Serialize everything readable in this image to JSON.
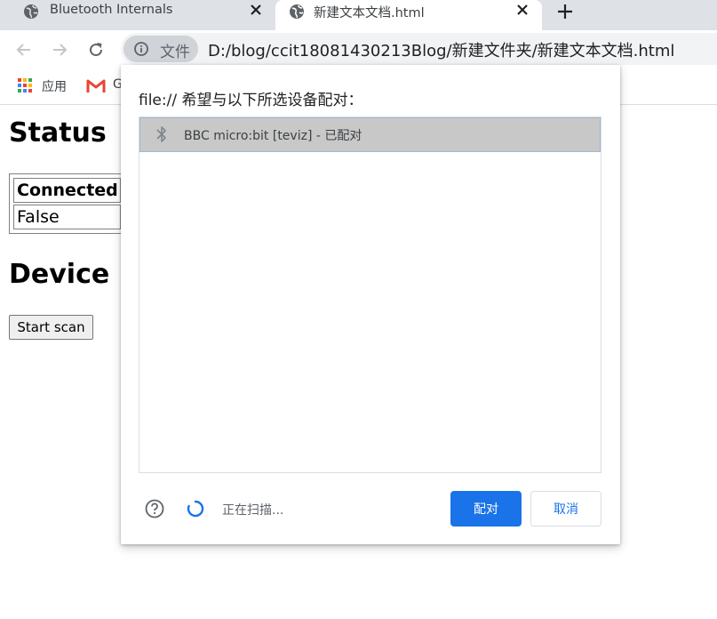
{
  "tabs": [
    {
      "title": "Bluetooth Internals",
      "favicon": "globe-icon",
      "close_icon": "close-icon",
      "active": false
    },
    {
      "title": "新建文本文档.html",
      "favicon": "globe-icon",
      "close_icon": "close-icon",
      "active": true
    }
  ],
  "new_tab_icon": "plus-icon",
  "toolbar": {
    "back_icon": "arrow-left-icon",
    "forward_icon": "arrow-right-icon",
    "reload_icon": "reload-icon",
    "site_info_icon": "info-icon",
    "scheme_label": "文件",
    "url": "D:/blog/ccit18081430213Blog/新建文件夹/新建文本文档.html"
  },
  "bookmarks": [
    {
      "label": "应用",
      "icon": "apps-grid-icon"
    },
    {
      "label": "G",
      "icon": "gmail-icon"
    }
  ],
  "page": {
    "status_heading": "Status",
    "status_table": {
      "header": "Connected",
      "value": "False"
    },
    "device_heading": "Device Discovery",
    "scan_button": "Start scan"
  },
  "dialog": {
    "title": "file:// 希望与以下所选设备配对：",
    "devices": [
      {
        "icon": "bluetooth-icon",
        "label": "BBC micro:bit [teviz] - 已配对",
        "selected": true
      }
    ],
    "help_icon": "help-circle-icon",
    "spinner_icon": "spinner-icon",
    "status_text": "正在扫描...",
    "pair_button": "配对",
    "cancel_button": "取消"
  },
  "colors": {
    "tabstrip_bg": "#dee1e6",
    "omnibox_bg": "#f1f3f4",
    "accent_blue": "#1a73e8",
    "selected_row": "#c8c8c8",
    "gmail_red": "#ea4335"
  }
}
